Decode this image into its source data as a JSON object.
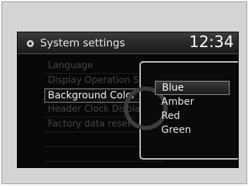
{
  "header": {
    "title": "System settings",
    "clock": "12:34",
    "icon": "gear-icon"
  },
  "menu": {
    "items": [
      {
        "label": "Language",
        "state": "dimmed"
      },
      {
        "label": "Display Operation Sound",
        "state": "dimmed"
      },
      {
        "label": "Background Color",
        "state": "selected"
      },
      {
        "label": "Header Clock Display",
        "state": "dimmed"
      },
      {
        "label": "Factory data reset",
        "state": "dimmed"
      },
      {
        "label": "",
        "state": "empty"
      },
      {
        "label": "",
        "state": "empty"
      }
    ]
  },
  "color_popup": {
    "options": [
      "Blue",
      "Amber",
      "Red",
      "Green"
    ],
    "selected": "Blue"
  }
}
